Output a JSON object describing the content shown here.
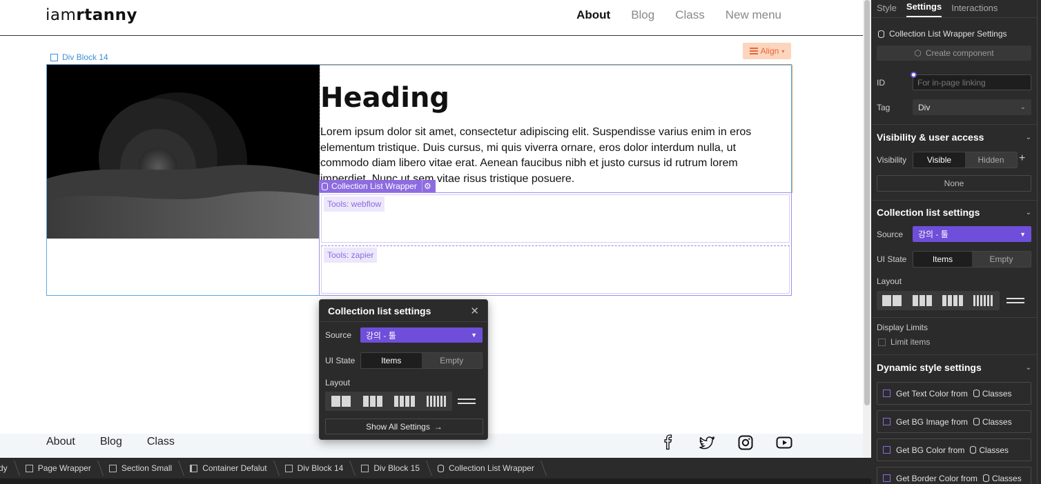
{
  "site": {
    "logo_light": "iam",
    "logo_bold": "rtanny",
    "nav": [
      "About",
      "Blog",
      "Class",
      "New menu"
    ]
  },
  "canvas": {
    "div_block_label": "Div Block 14",
    "align_label": "Align",
    "heading": "Heading",
    "paragraph": "Lorem ipsum dolor sit amet, consectetur adipiscing elit. Suspendisse varius enim in eros elementum tristique. Duis cursus, mi quis viverra ornare, eros dolor interdum nulla, ut commodo diam libero vitae erat. Aenean faucibus nibh et justo cursus id rutrum lorem imperdiet. Nunc ut sem vitae risus tristique posuere.",
    "collection_tag": "Collection List Wrapper",
    "items": [
      "Tools: webflow",
      "Tools: zapier"
    ]
  },
  "popover": {
    "title": "Collection list settings",
    "source_label": "Source",
    "source_value": "강의 - 툴",
    "ui_state_label": "UI State",
    "ui_state_options": [
      "Items",
      "Empty"
    ],
    "layout_label": "Layout",
    "show_all": "Show All Settings"
  },
  "footer": {
    "links": [
      "About",
      "Blog",
      "Class"
    ]
  },
  "breadcrumbs": [
    "dy",
    "Page Wrapper",
    "Section Small",
    "Container Defalut",
    "Div Block 14",
    "Div Block 15",
    "Collection List Wrapper"
  ],
  "panel": {
    "tabs": [
      "Style",
      "Settings",
      "Interactions"
    ],
    "settings_title": "Collection List Wrapper Settings",
    "create_component": "Create component",
    "id_label": "ID",
    "id_placeholder": "For in-page linking",
    "tag_label": "Tag",
    "tag_value": "Div",
    "visibility_section": "Visibility & user access",
    "visibility_label": "Visibility",
    "visibility_options": [
      "Visible",
      "Hidden"
    ],
    "none_value": "None",
    "collection_section": "Collection list settings",
    "source_label": "Source",
    "source_value": "강의 - 툴",
    "ui_state_label": "UI State",
    "ui_state_options": [
      "Items",
      "Empty"
    ],
    "layout_label": "Layout",
    "display_limits": "Display Limits",
    "limit_items": "Limit items",
    "dynamic_section": "Dynamic style settings",
    "dynamic_items": [
      {
        "prefix": "Get Text Color from",
        "suffix": "Classes"
      },
      {
        "prefix": "Get BG Image from",
        "suffix": "Classes"
      },
      {
        "prefix": "Get BG Color from",
        "suffix": "Classes"
      },
      {
        "prefix": "Get Border Color from",
        "suffix": "Classes"
      }
    ]
  },
  "colors": {
    "accent_purple": "#6f4ed9",
    "selection_blue": "#5ba7e0",
    "align_orange": "#e8663a",
    "panel_bg": "#2b2b2b"
  }
}
